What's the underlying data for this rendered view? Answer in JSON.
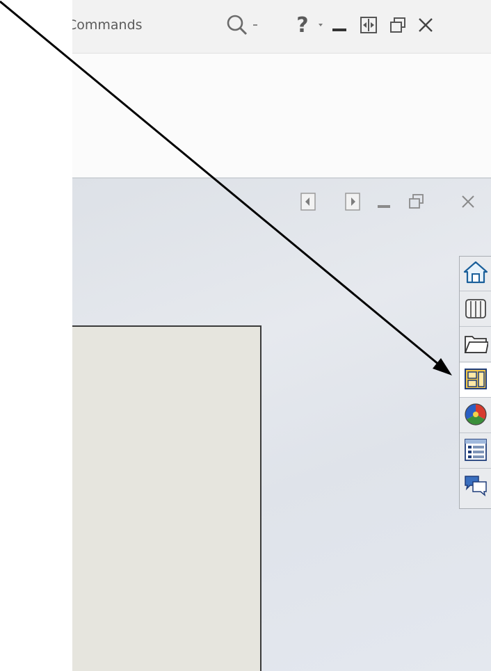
{
  "search": {
    "placeholder_text": "Commands",
    "icon": "search-icon"
  },
  "title_bar": {
    "help_label": "?",
    "icons": [
      "search-icon",
      "chevron-down-icon",
      "help-icon",
      "minimize-icon",
      "fit-window-icon",
      "restore-icon",
      "close-icon"
    ]
  },
  "document_window": {
    "icons": [
      "tile-left-icon",
      "tile-right-icon",
      "minimize-icon",
      "restore-icon",
      "close-icon"
    ]
  },
  "task_pane": {
    "tabs": [
      {
        "icon": "home-icon",
        "active": false
      },
      {
        "icon": "design-library-icon",
        "active": false
      },
      {
        "icon": "file-explorer-icon",
        "active": false
      },
      {
        "icon": "view-palette-icon",
        "active": true
      },
      {
        "icon": "appearances-icon",
        "active": false
      },
      {
        "icon": "custom-properties-icon",
        "active": false
      },
      {
        "icon": "forum-icon",
        "active": false
      }
    ]
  },
  "colors": {
    "topbar": "#f2f2f2",
    "graphics_bg": "#e1e5eb",
    "sheet": "#e6e5de",
    "arrow": "#000000"
  }
}
